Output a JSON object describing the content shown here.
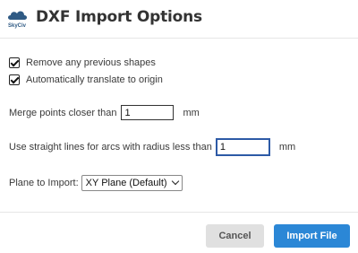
{
  "dialog": {
    "title": "DXF Import Options",
    "logo_text": "SkyCiv"
  },
  "options": {
    "remove_shapes": {
      "label": "Remove any previous shapes",
      "checked": true
    },
    "translate_origin": {
      "label": "Automatically translate to origin",
      "checked": true
    }
  },
  "merge": {
    "label": "Merge points closer than",
    "value": "1",
    "unit": "mm"
  },
  "arcs": {
    "label": "Use straight lines for arcs with radius less than",
    "value": "1",
    "unit": "mm"
  },
  "plane": {
    "label": "Plane to Import:",
    "selected": "XY Plane (Default)"
  },
  "footer": {
    "cancel_label": "Cancel",
    "import_label": "Import File"
  },
  "colors": {
    "accent": "#2b87d6",
    "logo": "#2f5a84",
    "focus": "#2d5aa6"
  }
}
